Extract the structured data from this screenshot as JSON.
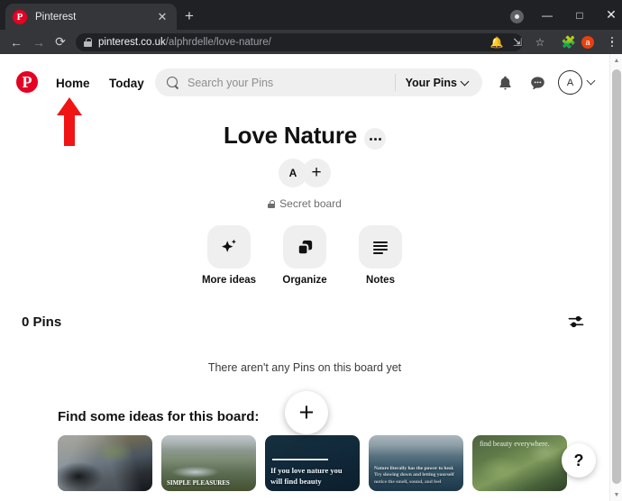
{
  "browser": {
    "tab": {
      "title": "Pinterest",
      "favicon": "pinterest-logo-icon",
      "close_icon": "close-icon"
    },
    "new_tab_icon": "plus-icon",
    "window_controls": {
      "minimize": "minimize-icon",
      "maximize": "maximize-icon",
      "close": "close-icon"
    },
    "nav": {
      "back_icon": "arrow-left-icon",
      "forward_icon": "arrow-right-icon",
      "reload_icon": "reload-icon"
    },
    "address": {
      "lock_icon": "lock-icon",
      "domain": "pinterest.co.uk",
      "path": "/alphrdelle/love-nature/",
      "icons": [
        "notifications-blocked-icon",
        "install-app-icon",
        "bookmark-star-icon"
      ]
    },
    "extensions_icon": "puzzle-piece-icon",
    "profile_initial": "a",
    "menu_icon": "three-dot-menu-icon",
    "title_bar_indicator_icon": "record-indicator-icon"
  },
  "site_header": {
    "logo": "pinterest-logo-icon",
    "nav": [
      {
        "label": "Home",
        "active": true
      },
      {
        "label": "Today",
        "active": false
      }
    ],
    "search": {
      "icon": "search-icon",
      "placeholder": "Search your Pins",
      "value": ""
    },
    "scope_selector": {
      "label": "Your Pins",
      "chevron": "chevron-down-icon"
    },
    "notifications_icon": "bell-icon",
    "messages_icon": "chat-bubble-icon",
    "avatar_initial": "A",
    "account_chevron": "chevron-down-icon"
  },
  "board": {
    "title": "Love Nature",
    "options_icon": "ellipsis-icon",
    "collaborator_initial": "A",
    "add_collaborator_icon": "plus-icon",
    "privacy": {
      "icon": "lock-icon",
      "label": "Secret board"
    },
    "actions": [
      {
        "label": "More ideas",
        "icon": "sparkle-icon"
      },
      {
        "label": "Organize",
        "icon": "copy-squares-icon"
      },
      {
        "label": "Notes",
        "icon": "notes-lines-icon"
      }
    ]
  },
  "pins_section": {
    "count_label": "0 Pins",
    "filter_icon": "filter-sliders-icon",
    "empty_message": "There aren't any Pins on this board yet"
  },
  "ideas_section": {
    "title": "Find some ideas for this board:",
    "thumbnails": [
      {
        "name": "rock-formation-thumbnail",
        "caption": ""
      },
      {
        "name": "lake-valley-thumbnail",
        "caption": "SIMPLE PLEASURES"
      },
      {
        "name": "find-beauty-quote-thumbnail",
        "caption": "If you love nature you will find beauty"
      },
      {
        "name": "lake-sunset-quote-thumbnail",
        "caption": "Nature literally has the power to heal. Try slowing down and letting yourself notice the smell, sound, and feel"
      },
      {
        "name": "green-nature-quote-thumbnail",
        "caption": "find beauty everywhere."
      }
    ]
  },
  "floating": {
    "create_icon": "plus-icon",
    "help_label": "?"
  },
  "annotation": {
    "type": "arrow-up",
    "color": "#f01414",
    "points_at": "Home"
  },
  "scrollbar": {
    "up_icon": "caret-up-icon",
    "down_icon": "caret-down-icon"
  }
}
